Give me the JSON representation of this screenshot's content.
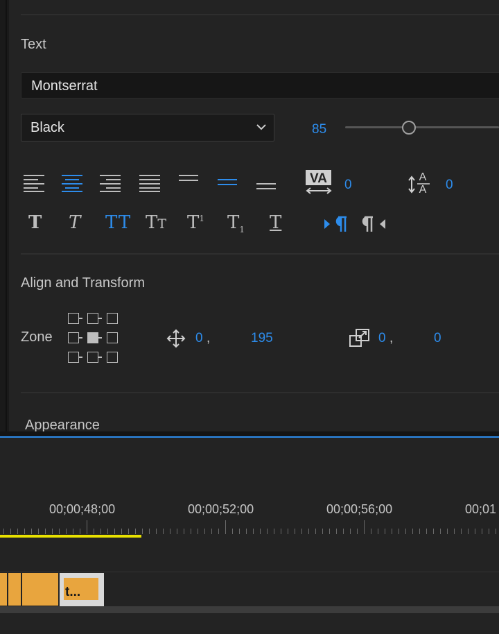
{
  "text_section": {
    "title": "Text",
    "font_family": "Montserrat",
    "font_style": "Black",
    "font_size": "85",
    "font_size_slider_fraction": 0.37,
    "tracking_value": "0",
    "leading_value": "0",
    "align_buttons": [
      "align-left",
      "align-center",
      "align-right",
      "justify-last-left",
      "justify-last-center",
      "justify-last-right",
      "justify-all"
    ],
    "active_align": "align-center"
  },
  "style_buttons": [
    "faux-bold",
    "faux-italic",
    "all-caps",
    "small-caps",
    "superscript",
    "subscript",
    "underline"
  ],
  "active_style": "all-caps",
  "direction_buttons": [
    "left-to-right",
    "right-to-left"
  ],
  "align_transform": {
    "title": "Align and Transform",
    "zone_label": "Zone",
    "position_x": "0",
    "position_y": "195",
    "separator": ",",
    "anchor_x": "0",
    "anchor_y": "0"
  },
  "appearance": {
    "title": "Appearance"
  },
  "timeline": {
    "timecodes": [
      "00;00;48;00",
      "00;00;52;00",
      "00;00;56;00",
      "00;01"
    ],
    "clip_label": "t..."
  },
  "colors": {
    "accent": "#2d8ceb",
    "clip": "#e8a53e",
    "work_area": "#e8e100"
  }
}
